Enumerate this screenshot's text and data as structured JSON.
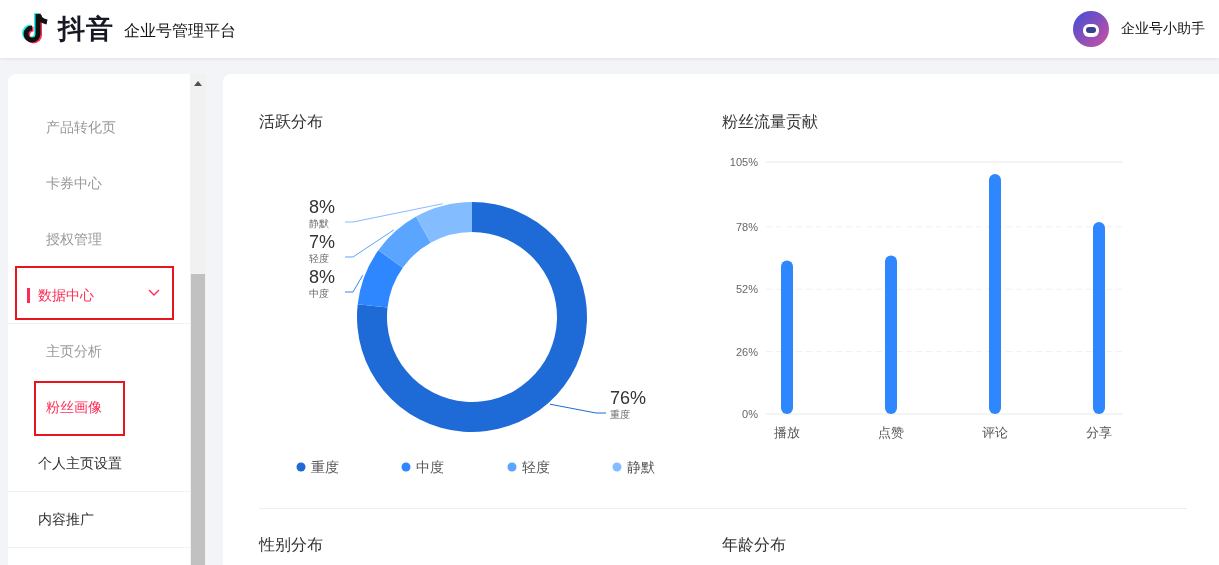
{
  "header": {
    "logo_text": "抖音",
    "platform_name": "企业号管理平台",
    "assistant_name": "企业号小助手"
  },
  "sidebar": {
    "items": [
      {
        "kind": "sub",
        "label": "产品转化页",
        "selected": false,
        "annotated": false
      },
      {
        "kind": "sub",
        "label": "卡券中心",
        "selected": false,
        "annotated": false
      },
      {
        "kind": "sub",
        "label": "授权管理",
        "selected": false,
        "annotated": false
      },
      {
        "kind": "group",
        "label": "数据中心",
        "expanded": true,
        "annotated": true,
        "children": [
          {
            "kind": "sub",
            "label": "主页分析",
            "selected": false,
            "annotated": false
          },
          {
            "kind": "sub",
            "label": "粉丝画像",
            "selected": true,
            "annotated": true
          }
        ]
      },
      {
        "kind": "group",
        "label": "个人主页设置",
        "expanded": false,
        "annotated": false
      },
      {
        "kind": "group",
        "label": "内容推广",
        "expanded": false,
        "annotated": false
      }
    ]
  },
  "panels": [
    {
      "title": "活跃分布",
      "chart_data": {
        "type": "donut",
        "categories": [
          "重度",
          "中度",
          "轻度",
          "静默"
        ],
        "values": [
          76,
          8,
          7,
          8
        ],
        "value_labels": [
          "76%",
          "8%",
          "7%",
          "8%"
        ]
      },
      "legend": [
        {
          "label": "重度",
          "color": "#1e6bd8"
        },
        {
          "label": "中度",
          "color": "#2f87ff"
        },
        {
          "label": "轻度",
          "color": "#5aa5ff"
        },
        {
          "label": "静默",
          "color": "#84bdff"
        }
      ]
    },
    {
      "title": "粉丝流量贡献",
      "chart_data": {
        "type": "bar",
        "categories": [
          "播放",
          "点赞",
          "评论",
          "分享"
        ],
        "values": [
          64,
          66,
          100,
          80
        ],
        "grid": true,
        "ylim": [
          0,
          105
        ],
        "yticks": [
          {
            "value": 0,
            "label": "0%"
          },
          {
            "value": 26,
            "label": "26%"
          },
          {
            "value": 52,
            "label": "52%"
          },
          {
            "value": 78,
            "label": "78%"
          },
          {
            "value": 105,
            "label": "105%"
          }
        ]
      }
    },
    {
      "title": "性别分布"
    },
    {
      "title": "年龄分布"
    }
  ]
}
